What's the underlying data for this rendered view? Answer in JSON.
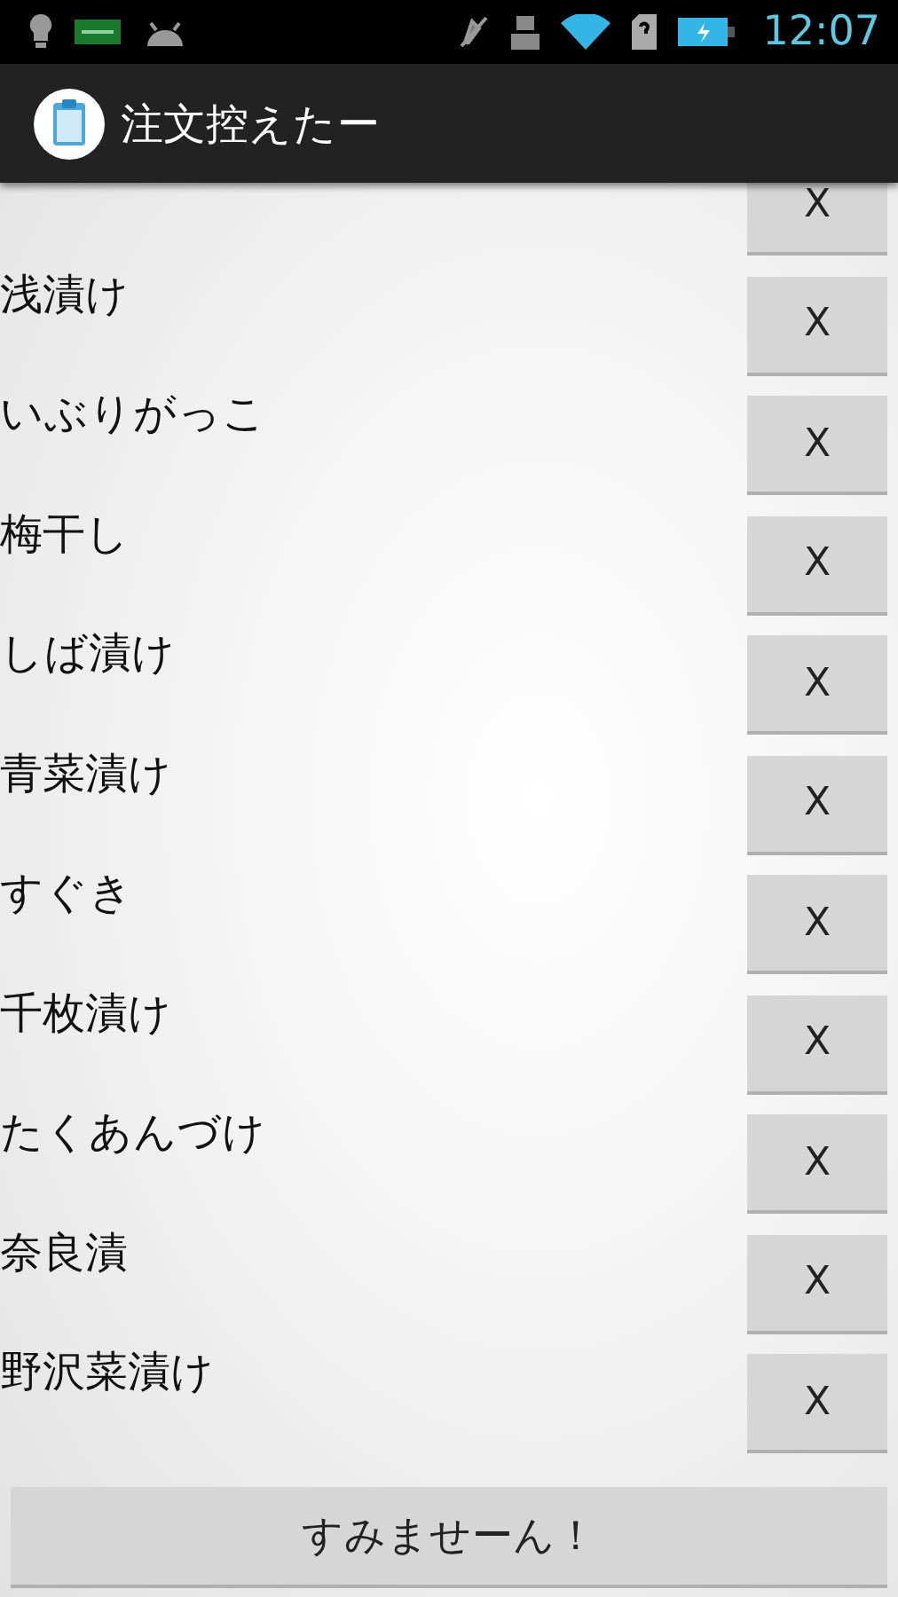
{
  "status_bar": {
    "time": "12:07"
  },
  "action_bar": {
    "title": "注文控えたー"
  },
  "items": [
    {
      "button": "X"
    },
    {
      "name": "浅漬け",
      "button": "X"
    },
    {
      "name": "いぶりがっこ",
      "button": "X"
    },
    {
      "name": "梅干し",
      "button": "X"
    },
    {
      "name": "しば漬け",
      "button": "X"
    },
    {
      "name": "青菜漬け",
      "button": "X"
    },
    {
      "name": "すぐき",
      "button": "X"
    },
    {
      "name": "千枚漬け",
      "button": "X"
    },
    {
      "name": "たくあんづけ",
      "button": "X"
    },
    {
      "name": "奈良漬",
      "button": "X"
    },
    {
      "name": "野沢菜漬け",
      "button": "X"
    }
  ],
  "footer_button": "すみませーん！"
}
